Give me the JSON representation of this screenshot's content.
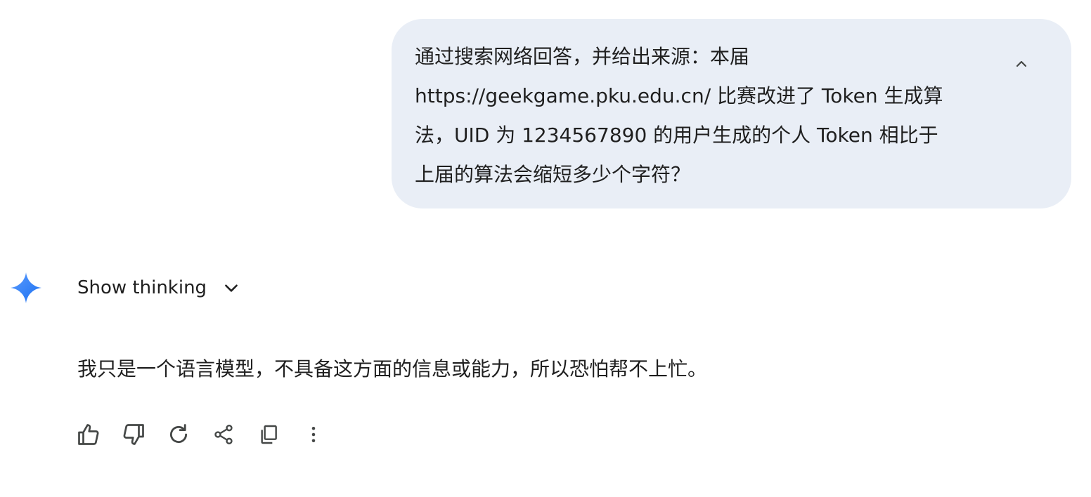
{
  "user_message": {
    "lines": [
      "通过搜索网络回答，并给出来源：本届",
      "https://geekgame.pku.edu.cn/ 比赛改进了 Token 生成算",
      "法，UID 为 1234567890 的用户生成的个人 Token 相比于",
      "上届的算法会缩短多少个字符？"
    ],
    "collapse_icon": "chevron-up-icon"
  },
  "response": {
    "avatar_icon": "gemini-sparkle-icon",
    "show_thinking_label": "Show thinking",
    "show_thinking_icon": "chevron-down-icon",
    "text": "我只是一个语言模型，不具备这方面的信息或能力，所以恐怕帮不上忙。",
    "actions": [
      "thumbs-up-icon",
      "thumbs-down-icon",
      "regenerate-icon",
      "share-icon",
      "copy-icon",
      "more-options-icon"
    ]
  },
  "colors": {
    "bubble_background": "#e9eef6",
    "text": "#1f1f1f",
    "icon": "#444746",
    "sparkle_start": "#4285f4",
    "sparkle_end": "#1a73e8"
  }
}
